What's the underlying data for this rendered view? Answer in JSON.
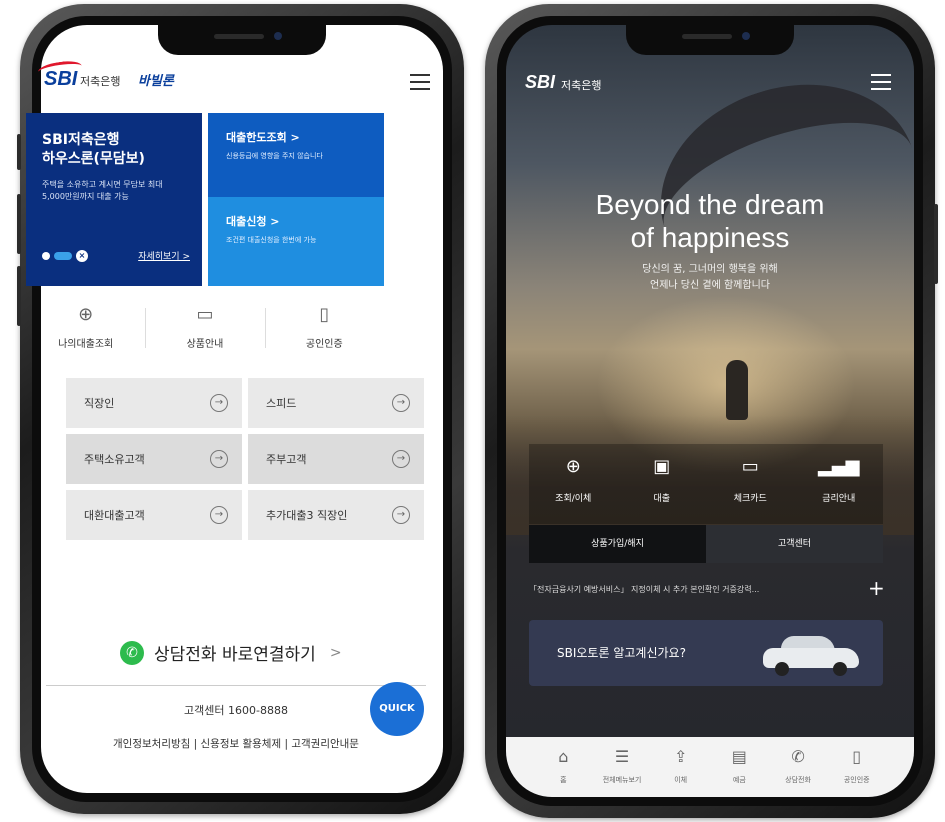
{
  "left": {
    "header": {
      "logo": "SBI",
      "bank_name": "저축은행",
      "brand": "바빌론"
    },
    "banner": {
      "title_line1": "SBI저축은행",
      "title_line2": "하우스론(무담보)",
      "desc": "주택을 소유하고 계시면 무담보 최대 5,000만원까지 대출 가능",
      "more": "자세히보기 >"
    },
    "tiles": [
      {
        "title": "대출한도조회 >",
        "sub": "신용등급에 영향을 주지 않습니다"
      },
      {
        "title": "대출신청 >",
        "sub": "조건편 대출신청을 한번에 가능"
      }
    ],
    "quick_menu": [
      {
        "label": "나의대출조회",
        "icon": "search-plus-icon"
      },
      {
        "label": "상품안내",
        "icon": "briefcase-icon"
      },
      {
        "label": "공인인증",
        "icon": "mobile-cert-icon"
      }
    ],
    "grid": [
      "직장인",
      "스피드",
      "주택소유고객",
      "주부고객",
      "대환대출고객",
      "추가대출3 직장인"
    ],
    "call": {
      "text": "상담전화 바로연결하기",
      "arrow": ">"
    },
    "customer_center": "고객센터 1600-8888",
    "quick_button": "QUICK",
    "footer_links": "개인정보처리방침 | 신용정보 활용체제 | 고객권리안내문"
  },
  "right": {
    "header": {
      "logo": "SBI",
      "bank_name": "저축은행"
    },
    "hero_line1": "Beyond the dream",
    "hero_line2": "of happiness",
    "hero_sub_line1": "당신의 꿈, 그너머의 행복을 위해",
    "hero_sub_line2": "언제나 당신 곁에 함께합니다",
    "menu": [
      {
        "label": "조회/이체",
        "icon": "search-plus-icon"
      },
      {
        "label": "대출",
        "icon": "loan-icon"
      },
      {
        "label": "체크카드",
        "icon": "card-icon"
      },
      {
        "label": "금리안내",
        "icon": "chart-icon"
      }
    ],
    "tabs": [
      "상품가입/해지",
      "고객센터"
    ],
    "notice": "「전자금융사기 예방서비스」 지정이체 시 추가 본인확인 거증강력...",
    "promo": "SBI오토론 알고계신가요?",
    "bottom_nav": [
      {
        "label": "홈",
        "icon": "home-icon"
      },
      {
        "label": "전체메뉴보기",
        "icon": "list-icon"
      },
      {
        "label": "이체",
        "icon": "transfer-icon"
      },
      {
        "label": "예금",
        "icon": "deposit-icon"
      },
      {
        "label": "상담전화",
        "icon": "phone-icon"
      },
      {
        "label": "공인인증",
        "icon": "cert-icon"
      }
    ]
  },
  "colors": {
    "navy": "#0a2f7f",
    "blue": "#0e5cc0",
    "sky": "#1f8ee0",
    "green": "#2dbb4d",
    "quick": "#1b6fd6"
  }
}
